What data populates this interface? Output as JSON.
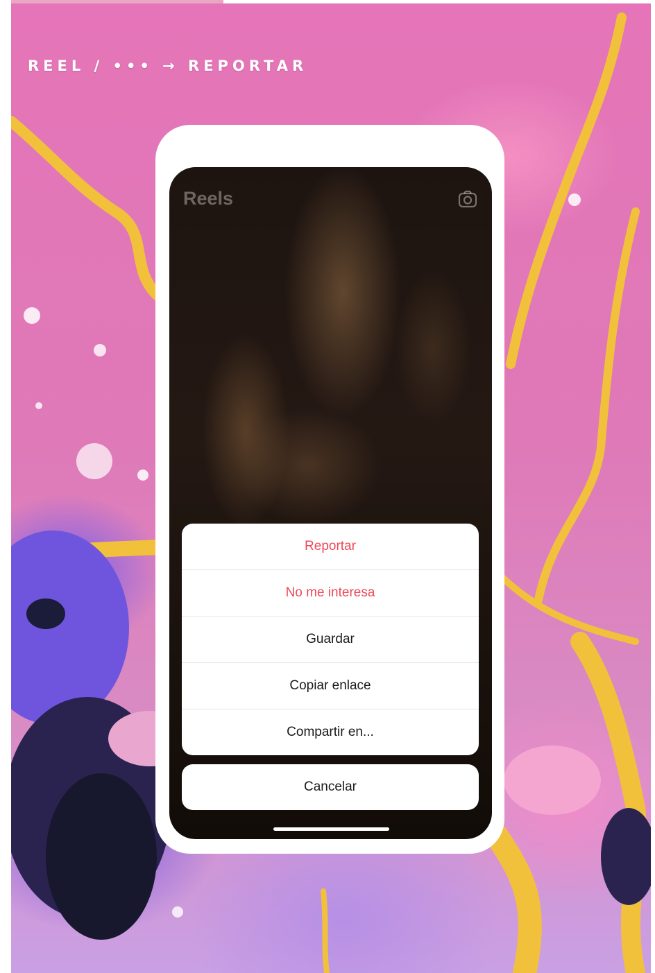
{
  "breadcrumb": "REEL / ••• → REPORTAR",
  "screen": {
    "title": "Reels",
    "camera_icon": "camera-icon"
  },
  "sheet": {
    "items": [
      {
        "label": "Reportar",
        "color": "#ed4956"
      },
      {
        "label": "No me interesa",
        "color": "#ed4956"
      },
      {
        "label": "Guardar",
        "color": "#1a1a1a"
      },
      {
        "label": "Copiar enlace",
        "color": "#1a1a1a"
      },
      {
        "label": "Compartir en...",
        "color": "#1a1a1a"
      }
    ],
    "cancel_label": "Cancelar"
  },
  "colors": {
    "danger": "#ed4956",
    "background_pink": "#df79b8",
    "phone_frame": "#ffffff"
  }
}
